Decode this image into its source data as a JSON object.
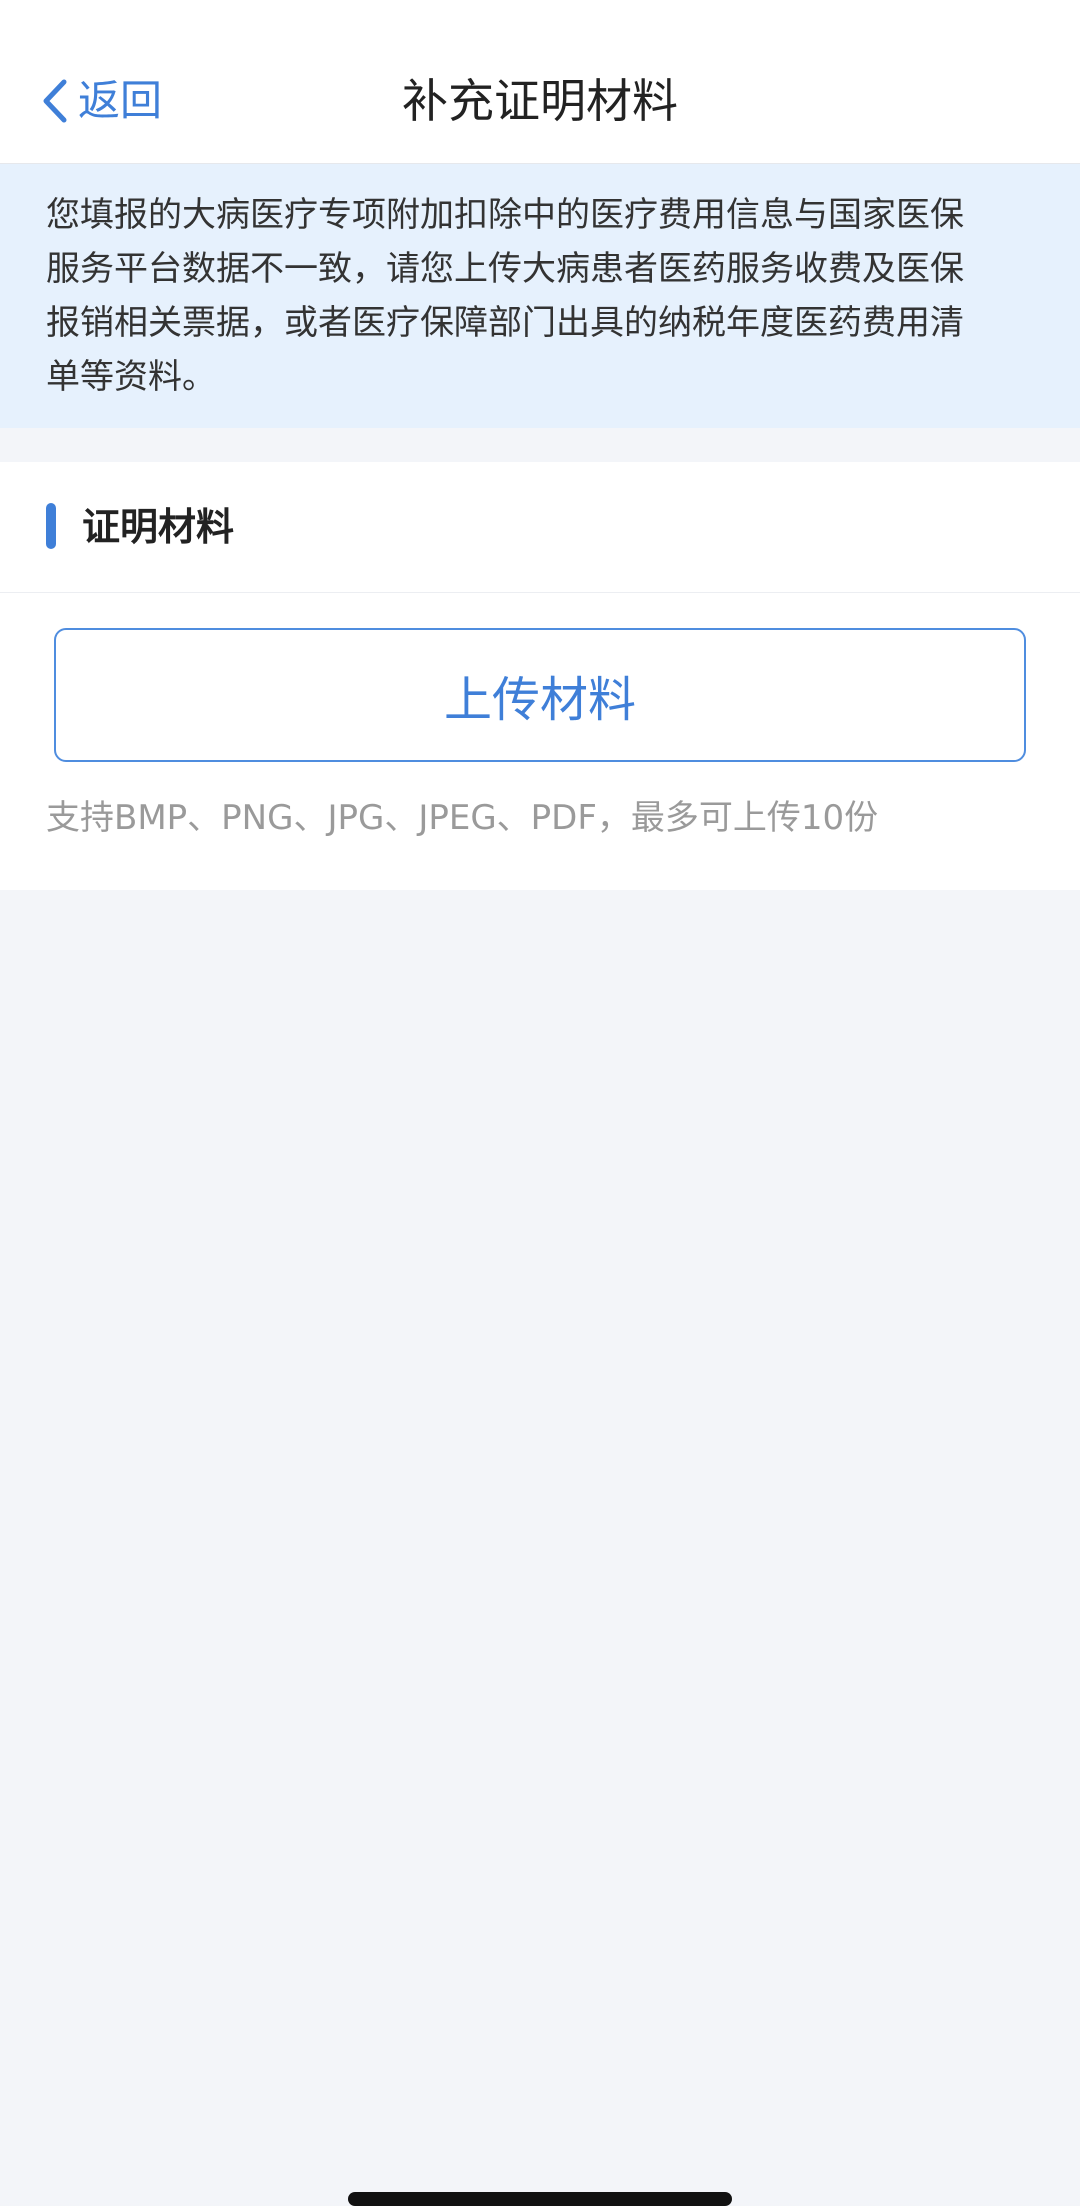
{
  "nav": {
    "back_label": "返回",
    "title": "补充证明材料"
  },
  "notice": {
    "lines": [
      "您填报的大病医疗专项附加扣除中的医疗费用信息与国家医保",
      "服务平台数据不一致，请您上传大病患者医药服务收费及医保",
      "报销相关票据，或者医疗保障部门出具的纳税年度医药费用清",
      "单等资料。"
    ]
  },
  "materials": {
    "section_title": "证明材料",
    "upload_label": "上传材料",
    "upload_hint": "支持BMP、PNG、JPG、JPEG、PDF，最多可上传10份"
  },
  "icons": {
    "back": "chevron-left-icon"
  },
  "colors": {
    "accent": "#3f7fd8",
    "notice_bg": "#e6f1fd",
    "page_bg": "#f3f5f9"
  }
}
